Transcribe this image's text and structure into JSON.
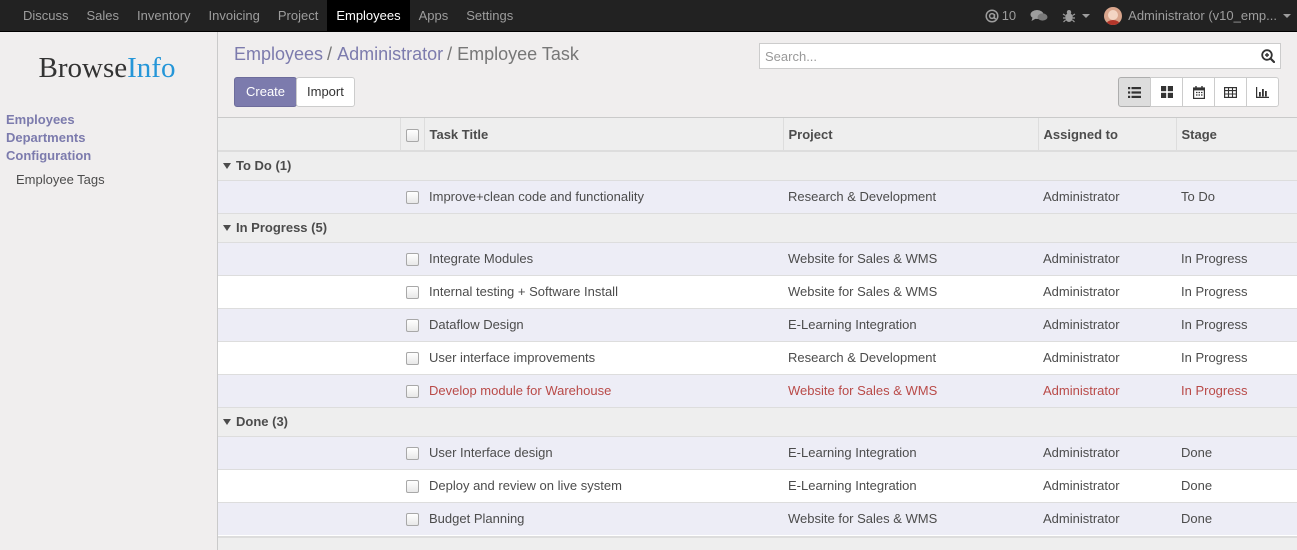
{
  "topbar": {
    "menu": [
      "Discuss",
      "Sales",
      "Inventory",
      "Invoicing",
      "Project",
      "Employees",
      "Apps",
      "Settings"
    ],
    "active": "Employees",
    "mentions_count": "10",
    "user_label": "Administrator (v10_emp..."
  },
  "sidebar": {
    "logo_part1": "Browse",
    "logo_part2": "Info",
    "items": [
      "Employees",
      "Departments",
      "Configuration"
    ],
    "sub_items": [
      "Employee Tags"
    ]
  },
  "breadcrumb": {
    "items": [
      "Employees",
      "Administrator"
    ],
    "current": "Employee Task",
    "separator": "/"
  },
  "search": {
    "placeholder": "Search..."
  },
  "buttons": {
    "create": "Create",
    "import": "Import"
  },
  "views": [
    "list",
    "kanban",
    "calendar",
    "pivot",
    "graph"
  ],
  "table": {
    "columns": [
      "Task Title",
      "Project",
      "Assigned to",
      "Stage"
    ],
    "groups": [
      {
        "label": "To Do (1)",
        "rows": [
          {
            "title": "Improve+clean code and functionality",
            "project": "Research & Development",
            "assigned": "Administrator",
            "stage": "To Do",
            "danger": false
          }
        ]
      },
      {
        "label": "In Progress (5)",
        "rows": [
          {
            "title": "Integrate Modules",
            "project": "Website for Sales & WMS",
            "assigned": "Administrator",
            "stage": "In Progress",
            "danger": false
          },
          {
            "title": "Internal testing + Software Install",
            "project": "Website for Sales & WMS",
            "assigned": "Administrator",
            "stage": "In Progress",
            "danger": false
          },
          {
            "title": "Dataflow Design",
            "project": "E-Learning Integration",
            "assigned": "Administrator",
            "stage": "In Progress",
            "danger": false
          },
          {
            "title": "User interface improvements",
            "project": "Research & Development",
            "assigned": "Administrator",
            "stage": "In Progress",
            "danger": false
          },
          {
            "title": "Develop module for Warehouse",
            "project": "Website for Sales & WMS",
            "assigned": "Administrator",
            "stage": "In Progress",
            "danger": true
          }
        ]
      },
      {
        "label": "Done (3)",
        "rows": [
          {
            "title": "User Interface design",
            "project": "E-Learning Integration",
            "assigned": "Administrator",
            "stage": "Done",
            "danger": false
          },
          {
            "title": "Deploy and review on live system",
            "project": "E-Learning Integration",
            "assigned": "Administrator",
            "stage": "Done",
            "danger": false
          },
          {
            "title": "Budget Planning",
            "project": "Website for Sales & WMS",
            "assigned": "Administrator",
            "stage": "Done",
            "danger": false
          }
        ]
      }
    ]
  },
  "colors": {
    "brand": "#7c7bad",
    "danger": "#b94a48",
    "logo_accent": "#2596d8",
    "topbar": "#222222"
  }
}
